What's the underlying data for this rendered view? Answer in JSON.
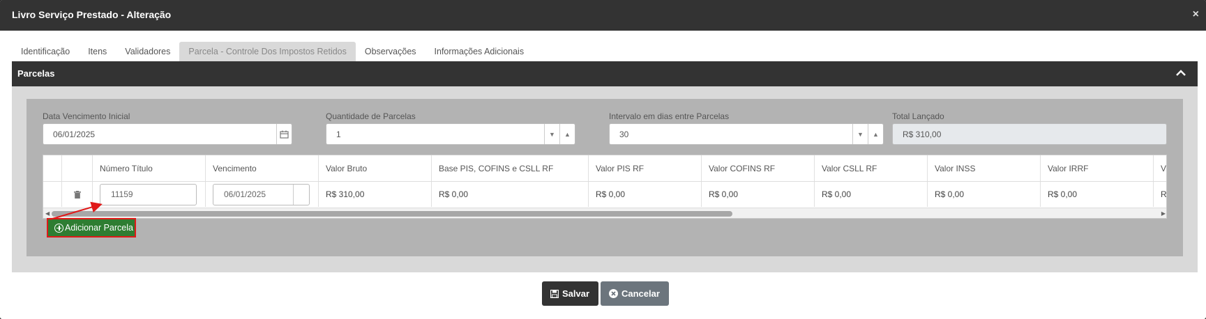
{
  "modal": {
    "title": "Livro Serviço Prestado - Alteração",
    "close_glyph": "×"
  },
  "tabs": [
    {
      "label": "Identificação",
      "active": false
    },
    {
      "label": "Itens",
      "active": false
    },
    {
      "label": "Validadores",
      "active": false
    },
    {
      "label": "Parcela - Controle Dos Impostos Retidos",
      "active": true
    },
    {
      "label": "Observações",
      "active": false
    },
    {
      "label": "Informações Adicionais",
      "active": false
    }
  ],
  "panel": {
    "title": "Parcelas"
  },
  "form": {
    "data_vencimento": {
      "label": "Data Vencimento Inicial",
      "value": "06/01/2025"
    },
    "quantidade": {
      "label": "Quantidade de Parcelas",
      "value": "1"
    },
    "intervalo": {
      "label": "Intervalo em dias entre Parcelas",
      "value": "30"
    },
    "total": {
      "label": "Total Lançado",
      "value": "R$ 310,00"
    }
  },
  "grid": {
    "columns": [
      "",
      "",
      "Número Título",
      "Vencimento",
      "Valor Bruto",
      "Base PIS, COFINS e CSLL RF",
      "Valor PIS RF",
      "Valor COFINS RF",
      "Valor CSLL RF",
      "Valor INSS",
      "Valor IRRF",
      "V"
    ],
    "rows": [
      {
        "numero_titulo": "11159",
        "vencimento": "06/01/2025",
        "valor_bruto": "R$ 310,00",
        "base_pis": "R$ 0,00",
        "valor_pis": "R$ 0,00",
        "valor_cofins": "R$ 0,00",
        "valor_csll": "R$ 0,00",
        "valor_inss": "R$ 0,00",
        "valor_irrf": "R$ 0,00",
        "cut": "R"
      }
    ]
  },
  "buttons": {
    "add": "Adicionar Parcela",
    "save": "Salvar",
    "cancel": "Cancelar"
  },
  "colors": {
    "accent_green": "#2e7d32",
    "highlight_red": "#e01919",
    "header_dark": "#333333"
  }
}
